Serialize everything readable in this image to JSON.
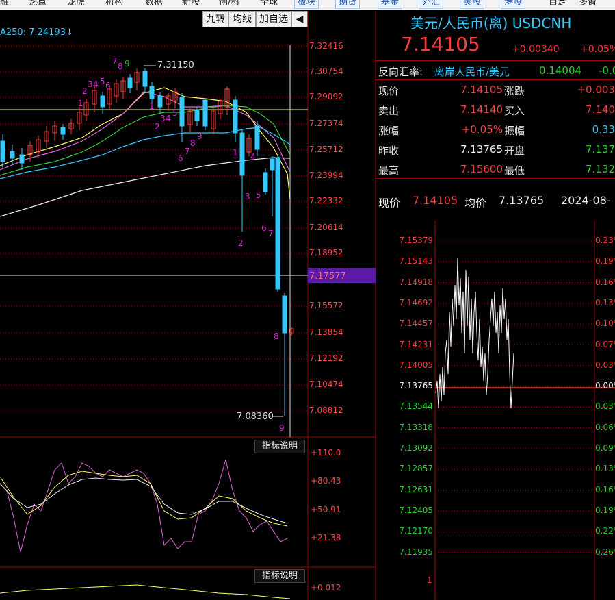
{
  "nav": {
    "items": [
      "融",
      "热点",
      "龙虎",
      "机构",
      "数据",
      "新股",
      "创/科",
      "全球"
    ],
    "boxed_items": [
      "板块",
      "期货",
      "基金",
      "外汇",
      "美股",
      "港股"
    ],
    "tail_items": [
      "自定",
      "多窗"
    ]
  },
  "toolbar": {
    "jiuzhuan": "九转",
    "junxian": "均线",
    "add_watch": "加自选",
    "arrow": "◀"
  },
  "ma_label": "A250: 7.24193↓",
  "price_axis": [
    "7.32416",
    "7.30754",
    "7.29092",
    "7.27374",
    "7.25712",
    "7.23994",
    "7.22332",
    "7.20614",
    "7.18952",
    "7.17577",
    "7.15572",
    "7.13854",
    "7.12192",
    "7.10474",
    "7.08812"
  ],
  "current_marker": "7.17577",
  "high_annotation": "7.31150",
  "low_annotation": "7.08360",
  "td_counts": {
    "top": [
      "1",
      "2",
      "3",
      "4",
      "5",
      "6",
      "7",
      "8",
      "9"
    ],
    "mid": [
      "1",
      "2",
      "3",
      "4",
      "5",
      "6",
      "7",
      "8",
      "9"
    ],
    "bottom": [
      "1",
      "2",
      "3",
      "4",
      "5",
      "6",
      "7",
      "8",
      "9"
    ]
  },
  "indicator1": {
    "btn": "指标说明",
    "labels": [
      "+110.0",
      "+80.43",
      "+50.91",
      "+21.38"
    ]
  },
  "indicator2": {
    "btn": "指标说明",
    "labels": [
      "+0.012"
    ]
  },
  "right_panel": {
    "title": "美元/人民币(离) USDCNH",
    "price": "7.14105",
    "change": "+0.00340",
    "change_pct": "+0.05%",
    "reverse_label": "反向汇率:",
    "reverse_pair": "离岸人民币/美元",
    "reverse_value": "0.14004",
    "reverse_change": "-0.0",
    "quote": [
      {
        "l1": "现价",
        "v1": "7.14105",
        "l2": "涨跌",
        "v2": "+0.003"
      },
      {
        "l1": "卖出",
        "v1": "7.14140",
        "l2": "买入",
        "v2": "7.140"
      },
      {
        "l1": "涨幅",
        "v1": "+0.05%",
        "l2": "振幅",
        "v2": "0.33"
      },
      {
        "l1": "昨收",
        "v1": "7.13765",
        "l2": "开盘",
        "v2": "7.137"
      },
      {
        "l1": "最高",
        "v1": "7.15600",
        "l2": "最低",
        "v2": "7.132"
      }
    ],
    "intraday_header": {
      "now_label": "现价",
      "now_val": "7.14105",
      "avg_label": "均价",
      "avg_val": "7.13765",
      "date": "2024-08-"
    },
    "intraday_left": [
      "7.15379",
      "7.15143",
      "7.14918",
      "7.14692",
      "7.14457",
      "7.14231",
      "7.14005",
      "7.13765",
      "7.13544",
      "7.13318",
      "7.13092",
      "7.12857",
      "7.12631",
      "7.12405",
      "7.12170",
      "7.11935"
    ],
    "intraday_right": [
      "0.23%",
      "0.19%",
      "0.16%",
      "0.13%",
      "0.10%",
      "0.07%",
      "0.03%",
      "0.00%",
      "0.03%",
      "0.06%",
      "0.09%",
      "0.13%",
      "0.16%",
      "0.19%",
      "0.22%",
      "0.26%"
    ],
    "volume_tick": "1"
  },
  "colors": {
    "up": "#ff3c3c",
    "down": "#35c8ff",
    "grid": "#a00000",
    "td_purple": "#d22bd2",
    "td_green": "#2bd22b",
    "marker": "#5a1aa6",
    "yellow": "#ffff66"
  }
}
